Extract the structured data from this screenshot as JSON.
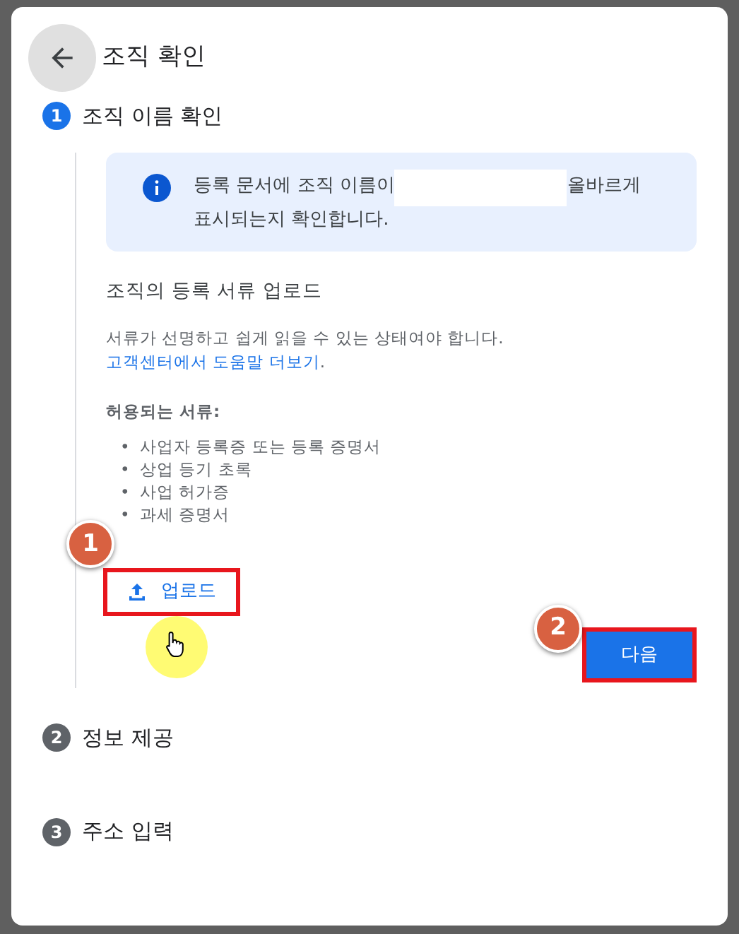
{
  "dialog": {
    "title": "조직 확인"
  },
  "steps": [
    {
      "number": "1",
      "label": "조직 이름 확인",
      "active": true
    },
    {
      "number": "2",
      "label": "정보 제공",
      "active": false
    },
    {
      "number": "3",
      "label": "주소 입력",
      "active": false
    }
  ],
  "notice": {
    "before": "등록 문서에 조직 이름이",
    "after": "올바르게",
    "second_line": "표시되는지 확인합니다.",
    "redacted": true
  },
  "upload_section": {
    "heading": "조직의 등록 서류 업로드",
    "help_text": "서류가 선명하고 쉽게 읽을 수 있는 상태여야 합니다.",
    "help_link": "고객센터에서 도움말 더보기",
    "help_end": ".",
    "allowed_label": "허용되는 서류:",
    "allowed_items": [
      {
        "marker": "•",
        "text": "사업자 등록증 또는 등록 증명서"
      },
      {
        "marker": "•",
        "text": "상업 등기 초록"
      },
      {
        "marker": "•",
        "text": "사업 허가증"
      },
      {
        "marker": "•",
        "text": "과세 증명서"
      }
    ],
    "upload_button": "업로드"
  },
  "next_button": "다음",
  "callouts": [
    "1",
    "2"
  ]
}
